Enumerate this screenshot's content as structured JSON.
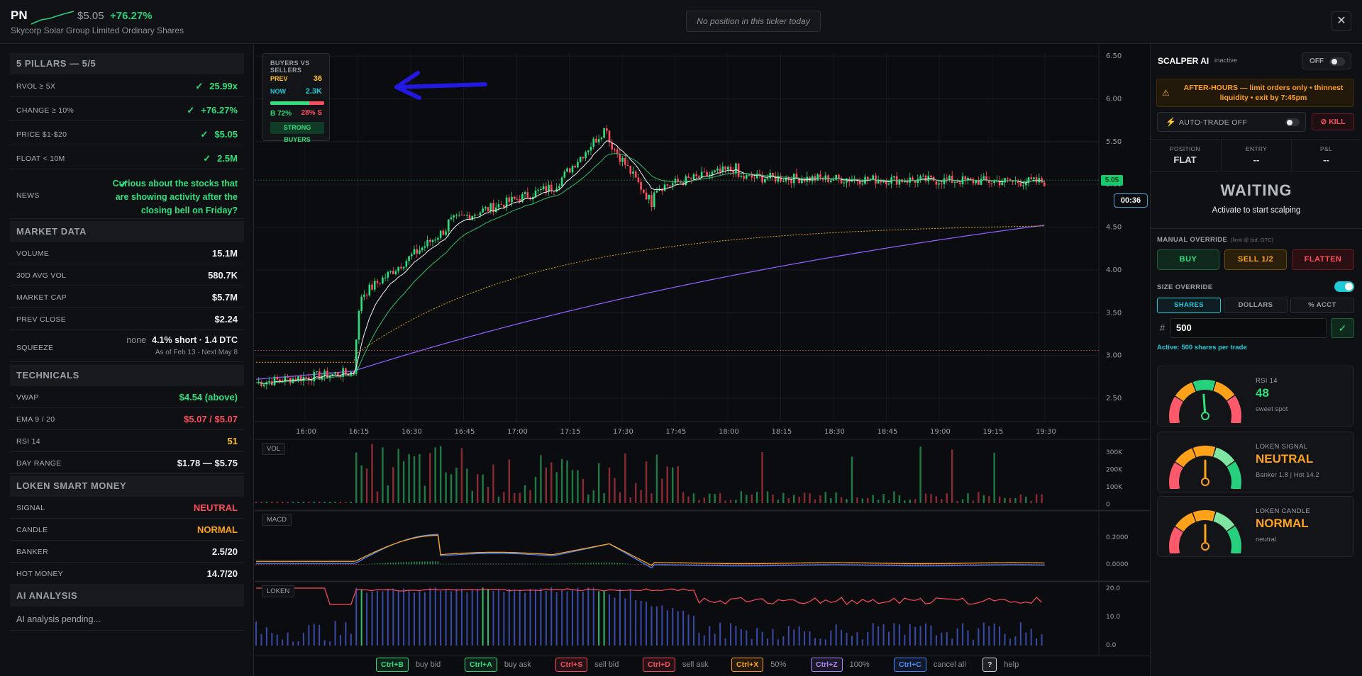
{
  "header": {
    "ticker": "PN",
    "price": "$5.05",
    "change": "+76.27%",
    "company": "Skycorp Solar Group Limited Ordinary Shares",
    "position_status": "No position in this ticker today",
    "close_icon": "close-icon"
  },
  "pillars": {
    "title": "5 PILLARS — 5/5",
    "rows": [
      {
        "label": "RVOL ≥ 5X",
        "value": "25.99x"
      },
      {
        "label": "CHANGE ≥ 10%",
        "value": "+76.27%"
      },
      {
        "label": "PRICE $1-$20",
        "value": "$5.05"
      },
      {
        "label": "FLOAT < 10M",
        "value": "2.5M"
      }
    ],
    "news_label": "NEWS",
    "news_text": "Curious about the stocks that are showing activity after the closing bell on Friday?"
  },
  "market_data": {
    "title": "MARKET DATA",
    "rows": [
      {
        "label": "VOLUME",
        "value": "15.1M"
      },
      {
        "label": "30D AVG VOL",
        "value": "580.7K"
      },
      {
        "label": "MARKET CAP",
        "value": "$5.7M"
      },
      {
        "label": "PREV CLOSE",
        "value": "$2.24"
      }
    ],
    "squeeze_label": "SQUEEZE",
    "squeeze_none": "none",
    "squeeze_value": "4.1% short · 1.4 DTC",
    "squeeze_date": "As of Feb 13 · Next May 8"
  },
  "technicals": {
    "title": "TECHNICALS",
    "rows": [
      {
        "label": "VWAP",
        "value": "$4.54 (above)"
      },
      {
        "label": "EMA 9 / 20",
        "value": "$5.07 / $5.07"
      },
      {
        "label": "RSI 14",
        "value": "51"
      },
      {
        "label": "DAY RANGE",
        "value": "$1.78 — $5.75"
      }
    ]
  },
  "loken": {
    "title": "LOKEN SMART MONEY",
    "rows": [
      {
        "label": "SIGNAL",
        "value": "NEUTRAL"
      },
      {
        "label": "CANDLE",
        "value": "NORMAL"
      },
      {
        "label": "BANKER",
        "value": "2.5/20"
      },
      {
        "label": "HOT MONEY",
        "value": "14.7/20"
      }
    ]
  },
  "ai": {
    "title": "AI ANALYSIS",
    "text": "AI analysis pending..."
  },
  "buyers_sellers": {
    "title": "BUYERS VS SELLERS",
    "prev_label": "PREV",
    "prev_value": "36",
    "now_label": "NOW",
    "now_value": "2.3K",
    "buy_pct": "B 72%",
    "sell_pct": "28% S",
    "buy_fraction": 0.72,
    "badge": "STRONG BUYERS"
  },
  "chart": {
    "last_price": "5.05",
    "timer": "00:36",
    "price_ticks": [
      "6.50",
      "6.00",
      "5.50",
      "5.00",
      "4.50",
      "4.00",
      "3.50",
      "3.00",
      "2.50"
    ],
    "time_ticks": [
      "16:00",
      "16:15",
      "16:30",
      "16:45",
      "17:00",
      "17:15",
      "17:30",
      "17:45",
      "18:00",
      "18:15",
      "18:30",
      "18:45",
      "19:00",
      "19:15",
      "19:30"
    ],
    "vol_tag": "VOL",
    "vol_ticks": [
      "300K",
      "200K",
      "100K",
      "0"
    ],
    "macd_tag": "MACD",
    "macd_ticks": [
      "0.2000",
      "0.0000"
    ],
    "loken_tag": "LOKEN",
    "loken_ticks": [
      "20.0",
      "10.0",
      "0.0"
    ]
  },
  "shortcuts": [
    {
      "key": "Ctrl+B",
      "action": "buy bid",
      "color": "#2fe07f"
    },
    {
      "key": "Ctrl+A",
      "action": "buy ask",
      "color": "#2fe07f"
    },
    {
      "key": "Ctrl+S",
      "action": "sell bid",
      "color": "#ff4d5e"
    },
    {
      "key": "Ctrl+D",
      "action": "sell ask",
      "color": "#ff4d5e"
    },
    {
      "key": "Ctrl+X",
      "action": "50%",
      "color": "#ffa21a"
    },
    {
      "key": "Ctrl+Z",
      "action": "100%",
      "color": "#b388ff"
    },
    {
      "key": "Ctrl+C",
      "action": "cancel all",
      "color": "#4a8cff"
    },
    {
      "key": "?",
      "action": "help",
      "color": "#d8dbe0"
    }
  ],
  "scalper": {
    "title": "SCALPER AI",
    "status": "inactive",
    "off_label": "OFF",
    "after_hours": "AFTER-HOURS — limit orders only • thinnest liquidity • exit by 7:45pm",
    "autotrade_label": "AUTO-TRADE OFF",
    "kill_label": "KILL",
    "position_label": "POSITION",
    "position_value": "FLAT",
    "entry_label": "ENTRY",
    "entry_value": "--",
    "pnl_label": "P&L",
    "pnl_value": "--",
    "waiting": "WAITING",
    "waiting_sub": "Activate to start scalping",
    "manual_override": "MANUAL OVERRIDE",
    "manual_sub": "(limit @ bid, GTC)",
    "buy": "BUY",
    "sell_half": "SELL 1/2",
    "flatten": "FLATTEN",
    "size_override": "SIZE OVERRIDE",
    "tab_shares": "SHARES",
    "tab_dollars": "DOLLARS",
    "tab_pct": "% ACCT",
    "hash": "#",
    "qty": "500",
    "active_text": "Active: 500 shares per trade"
  },
  "gauges": [
    {
      "title": "RSI 14",
      "value": "48",
      "sub": "sweet spot",
      "color": "#2fe07f",
      "needle": 0.48
    },
    {
      "title": "LOKEN SIGNAL",
      "value": "NEUTRAL",
      "sub": "Banker 1.8 | Hot 14.2",
      "color": "#ffa21a",
      "needle": 0.5
    },
    {
      "title": "LOKEN CANDLE",
      "value": "NORMAL",
      "sub": "neutral",
      "color": "#ffa21a",
      "needle": 0.5
    }
  ]
}
